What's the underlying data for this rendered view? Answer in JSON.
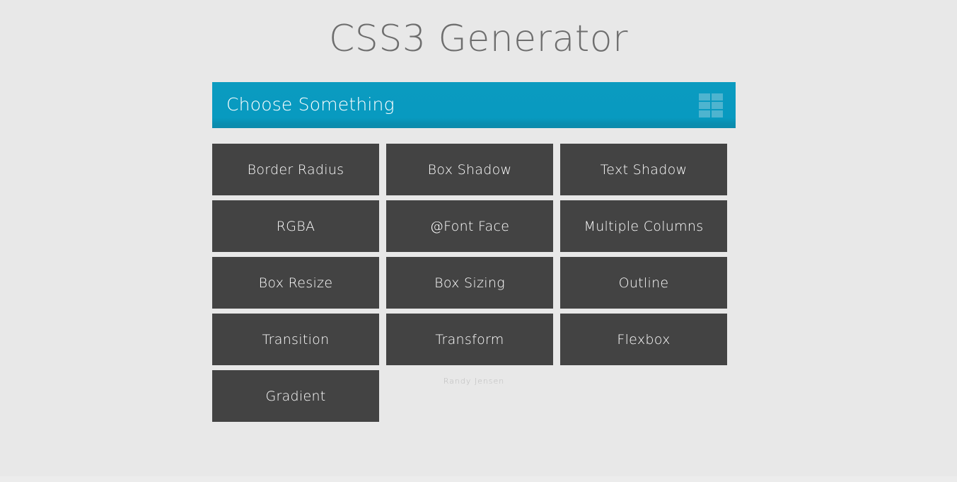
{
  "page": {
    "title": "CSS3 Generator",
    "background_color": "#e8e8e8",
    "title_color": "#6e6e6e"
  },
  "header_bar": {
    "label": "Choose Something",
    "background_color": "#0b98bd",
    "text_color": "#ffffff",
    "grid_icon": {
      "name": "grid-icon",
      "tile_color": "#4eb4cf",
      "columns": 2,
      "rows": 3,
      "tiles": [
        1,
        2,
        3,
        4,
        5,
        6
      ]
    }
  },
  "generator_buttons": {
    "background_color": "#434343",
    "text_color": "#ffffff",
    "items": [
      {
        "label": "Border Radius",
        "slug": "border-radius"
      },
      {
        "label": "Box Shadow",
        "slug": "box-shadow"
      },
      {
        "label": "Text Shadow",
        "slug": "text-shadow"
      },
      {
        "label": "RGBA",
        "slug": "rgba"
      },
      {
        "label": "@Font Face",
        "slug": "font-face"
      },
      {
        "label": "Multiple Columns",
        "slug": "multiple-columns"
      },
      {
        "label": "Box Resize",
        "slug": "box-resize"
      },
      {
        "label": "Box Sizing",
        "slug": "box-sizing"
      },
      {
        "label": "Outline",
        "slug": "outline"
      },
      {
        "label": "Transition",
        "slug": "transition"
      },
      {
        "label": "Transform",
        "slug": "transform"
      },
      {
        "label": "Flexbox",
        "slug": "flexbox"
      },
      {
        "label": "Gradient",
        "slug": "gradient"
      }
    ]
  },
  "footer": {
    "credit": "Randy Jensen",
    "color": "#b9b9b9"
  }
}
